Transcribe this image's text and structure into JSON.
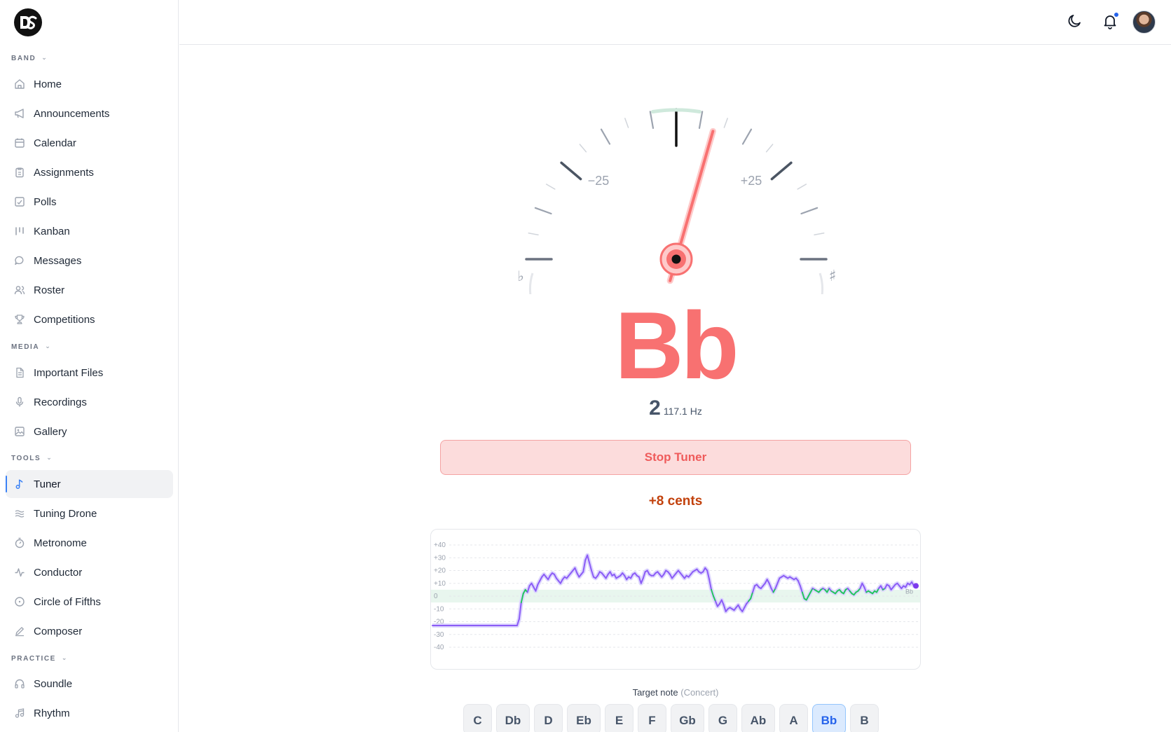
{
  "sidebar": {
    "logo": "DS",
    "sections": [
      {
        "label": "BAND",
        "items": [
          {
            "label": "Home",
            "icon": "home-icon"
          },
          {
            "label": "Announcements",
            "icon": "megaphone-icon"
          },
          {
            "label": "Calendar",
            "icon": "calendar-icon"
          },
          {
            "label": "Assignments",
            "icon": "clipboard-icon"
          },
          {
            "label": "Polls",
            "icon": "poll-icon"
          },
          {
            "label": "Kanban",
            "icon": "kanban-icon"
          },
          {
            "label": "Messages",
            "icon": "message-icon"
          },
          {
            "label": "Roster",
            "icon": "users-icon"
          },
          {
            "label": "Competitions",
            "icon": "trophy-icon"
          }
        ]
      },
      {
        "label": "MEDIA",
        "items": [
          {
            "label": "Important Files",
            "icon": "file-icon"
          },
          {
            "label": "Recordings",
            "icon": "microphone-icon"
          },
          {
            "label": "Gallery",
            "icon": "gallery-icon"
          }
        ]
      },
      {
        "label": "TOOLS",
        "items": [
          {
            "label": "Tuner",
            "icon": "music-note-icon",
            "active": true
          },
          {
            "label": "Tuning Drone",
            "icon": "waves-icon"
          },
          {
            "label": "Metronome",
            "icon": "timer-icon"
          },
          {
            "label": "Conductor",
            "icon": "activity-icon"
          },
          {
            "label": "Circle of Fifths",
            "icon": "circle-icon"
          },
          {
            "label": "Composer",
            "icon": "pen-icon"
          }
        ]
      },
      {
        "label": "PRACTICE",
        "items": [
          {
            "label": "Soundle",
            "icon": "headphones-icon"
          },
          {
            "label": "Rhythm",
            "icon": "music-notes-icon"
          }
        ]
      }
    ]
  },
  "topbar": {
    "icons": [
      "moon-icon",
      "bell-icon",
      "avatar"
    ]
  },
  "tuner": {
    "gauge": {
      "minus_label": "−25",
      "plus_label": "+25",
      "flat_symbol": "♭",
      "sharp_symbol": "♯",
      "needle_cents": 8
    },
    "note": "Bb",
    "octave": "2",
    "frequency": "117.1 Hz",
    "stop_button": "Stop Tuner",
    "cents_readout": "+8 cents",
    "target_label": "Target note",
    "target_sub": "(Concert)",
    "notes": [
      "C",
      "Db",
      "D",
      "Eb",
      "E",
      "F",
      "Gb",
      "G",
      "Ab",
      "A",
      "Bb",
      "B"
    ],
    "selected_note": "Bb"
  },
  "chart_data": {
    "type": "line",
    "title": "",
    "y_ticks": [
      "+40",
      "+30",
      "+20",
      "+10",
      "0",
      "-10",
      "-20",
      "-30",
      "-40"
    ],
    "ylim": [
      -40,
      40
    ],
    "in_tune_band": [
      -5,
      5
    ],
    "end_label": "Bb",
    "series": [
      {
        "values": [
          -23,
          -23,
          -23,
          -23,
          -23,
          -23,
          -23,
          -23,
          -23,
          -23,
          -23,
          -23,
          -23,
          -23,
          -23,
          -23,
          -23,
          -23,
          -23,
          -23,
          -23,
          -23,
          -23,
          -23,
          -23,
          -23,
          -23,
          -23,
          -23,
          -23,
          -23,
          -23,
          -23,
          -23,
          -23,
          -23,
          -23,
          -23,
          -23,
          -23,
          -23,
          -23,
          -18,
          -5,
          2,
          5,
          3,
          8,
          10,
          7,
          4,
          9,
          12,
          15,
          17,
          15,
          13,
          16,
          18,
          17,
          14,
          12,
          10,
          13,
          15,
          14,
          16,
          18,
          20,
          22,
          18,
          15,
          17,
          19,
          28,
          32,
          26,
          20,
          15,
          14,
          16,
          19,
          18,
          16,
          14,
          17,
          19,
          16,
          17,
          14,
          15,
          16,
          18,
          16,
          13,
          15,
          14,
          17,
          18,
          16,
          15,
          10,
          14,
          19,
          20,
          17,
          16,
          16,
          18,
          19,
          17,
          15,
          17,
          20,
          19,
          17,
          14,
          16,
          18,
          20,
          18,
          16,
          14,
          16,
          15,
          17,
          19,
          20,
          21,
          19,
          18,
          19,
          22,
          20,
          13,
          5,
          0,
          -4,
          -8,
          -6,
          -3,
          -7,
          -12,
          -10,
          -9,
          -10,
          -11,
          -9,
          -7,
          -10,
          -12,
          -9,
          -6,
          -4,
          -2,
          3,
          8,
          9,
          7,
          6,
          8,
          10,
          13,
          10,
          6,
          3,
          6,
          10,
          14,
          15,
          16,
          15,
          14,
          15,
          14,
          13,
          14,
          12,
          8,
          3,
          -2,
          -3,
          0,
          3,
          6,
          5,
          4,
          3,
          5,
          6,
          5,
          3,
          6,
          4,
          3,
          2,
          4,
          5,
          3,
          2,
          5,
          6,
          4,
          2,
          1,
          3,
          4,
          6,
          10,
          7,
          3,
          4,
          3,
          2,
          4,
          3,
          6,
          8,
          5,
          6,
          9,
          8,
          5,
          7,
          9,
          10,
          8,
          6,
          8,
          7,
          10,
          9,
          11,
          8,
          8
        ]
      }
    ]
  }
}
